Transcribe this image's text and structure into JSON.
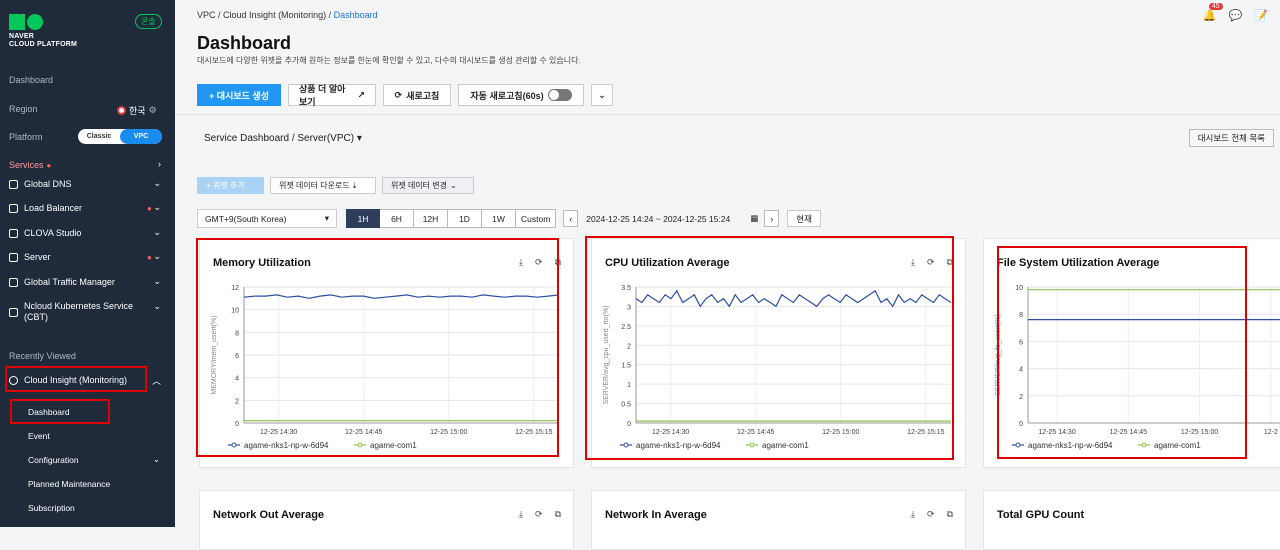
{
  "sidebar": {
    "logo_line1": "NAVER",
    "logo_line2": "CLOUD PLATFORM",
    "badge": "콘솔",
    "dashboard_label": "Dashboard",
    "region_label": "Region",
    "region_value": "한국",
    "platform_label": "Platform",
    "platform_options": [
      "Classic",
      "VPC"
    ],
    "platform_selected": "VPC",
    "services_label": "Services",
    "items": [
      {
        "label": "Global DNS",
        "dot": false
      },
      {
        "label": "Load Balancer",
        "dot": true
      },
      {
        "label": "CLOVA Studio",
        "dot": false
      },
      {
        "label": "Server",
        "dot": true
      },
      {
        "label": "Global Traffic Manager",
        "dot": false
      },
      {
        "label": "Ncloud Kubernetes Service (CBT)",
        "dot": false
      }
    ],
    "recently_viewed_label": "Recently Viewed",
    "recent_item": "Cloud Insight (Monitoring)",
    "sub_items": [
      "Dashboard",
      "Event",
      "Configuration",
      "Planned Maintenance",
      "Subscription"
    ]
  },
  "header": {
    "breadcrumb": [
      "VPC",
      "Cloud Insight (Monitoring)",
      "Dashboard"
    ],
    "notification_count": "45",
    "title": "Dashboard",
    "description": "대시보드에 다양한 위젯을 추가해 원하는 정보를 한눈에 확인할 수 있고, 다수의 대시보드를 생성 관리할 수 있습니다."
  },
  "toolbar": {
    "create_label": "+ 대시보드 생성",
    "more_label": "상품 더 알아보기",
    "refresh_label": "새로고침",
    "auto_refresh_label": "자동 새로고침(60s)"
  },
  "dashboard_bar": {
    "selected": "Service Dashboard / Server(VPC)",
    "all_list_label": "대시보드 전체 목록"
  },
  "widget_bar": {
    "add_label": "+ 위젯 추가",
    "download_label": "위젯 데이터 다운로드",
    "change_label": "위젯 데이터 변경"
  },
  "time_bar": {
    "timezone": "GMT+9(South Korea)",
    "ranges": [
      "1H",
      "6H",
      "12H",
      "1D",
      "1W",
      "Custom"
    ],
    "active_range": "1H",
    "date_range": "2024-12-25 14:24 ~ 2024-12-25 15:24",
    "now_label": "현재"
  },
  "widgets": [
    {
      "title": "Memory Utilization"
    },
    {
      "title": "CPU Utilization Average"
    },
    {
      "title": "File System Utilization Average"
    },
    {
      "title": "Network Out Average"
    },
    {
      "title": "Network In Average"
    },
    {
      "title": "Total GPU Count"
    }
  ],
  "chart_data": [
    {
      "type": "line",
      "title": "Memory Utilization",
      "ylabel": "MEMORY/mem_usert(%)",
      "ylim": [
        0,
        12
      ],
      "yticks": [
        0,
        2,
        4,
        6,
        8,
        10,
        12
      ],
      "xticks": [
        "12-25 14:30",
        "12-25 14:45",
        "12-25 15:00",
        "12-25 15:15"
      ],
      "series": [
        {
          "name": "agame-nks1-np-w-6d94",
          "color": "#2b4fa0",
          "values": [
            11.1,
            11.2,
            11.2,
            11.3,
            11.1,
            11.2,
            11.0,
            11.2,
            11.3,
            11.1,
            11.2,
            11.2,
            11.0,
            11.1,
            11.2,
            11.3,
            11.1,
            11.2,
            11.1,
            11.2,
            11.2,
            11.1,
            11.3,
            11.2,
            11.1,
            11.2,
            11.2,
            11.1,
            11.2,
            11.3
          ]
        },
        {
          "name": "agame-com1",
          "color": "#8bc34a",
          "values": [
            0.2,
            0.2,
            0.2,
            0.2,
            0.2,
            0.2,
            0.2,
            0.2,
            0.2,
            0.2,
            0.2,
            0.2,
            0.2,
            0.2,
            0.2,
            0.2,
            0.2,
            0.2,
            0.2,
            0.2,
            0.2,
            0.2,
            0.2,
            0.2,
            0.2,
            0.2,
            0.2,
            0.2,
            0.2,
            0.2
          ]
        }
      ]
    },
    {
      "type": "line",
      "title": "CPU Utilization Average",
      "ylabel": "SERVER/avg_cpu_used_rto(%)",
      "ylim": [
        0,
        3.5
      ],
      "yticks": [
        0,
        0.5,
        1,
        1.5,
        2,
        2.5,
        3,
        3.5
      ],
      "xticks": [
        "12-25 14:30",
        "12-25 14:45",
        "12-25 15:00",
        "12-25 15:15"
      ],
      "series": [
        {
          "name": "agame-nks1-np-w-6d94",
          "color": "#2b4fa0",
          "values": [
            3.2,
            3.1,
            3.3,
            3.2,
            3.1,
            3.3,
            3.2,
            3.4,
            3.1,
            3.2,
            3.3,
            3.0,
            3.2,
            3.3,
            3.1,
            3.2,
            3.0,
            3.3,
            3.1,
            3.2,
            3.3,
            3.1,
            3.2,
            3.1,
            3.0,
            3.3,
            3.2,
            3.1,
            3.3,
            3.2,
            3.1,
            3.0,
            3.2,
            3.3,
            3.2,
            3.1,
            3.3,
            3.2,
            3.1,
            3.2,
            3.3,
            3.4,
            3.1,
            3.2,
            3.0,
            3.3,
            3.1,
            3.2,
            3.1,
            3.3,
            3.2,
            3.1,
            3.3,
            3.2,
            3.1
          ]
        },
        {
          "name": "agame-com1",
          "color": "#8bc34a",
          "values": [
            0.05,
            0.05,
            0.05,
            0.05,
            0.05,
            0.05,
            0.05,
            0.05,
            0.05,
            0.05,
            0.05,
            0.05,
            0.05,
            0.05,
            0.05,
            0.05,
            0.05,
            0.05,
            0.05,
            0.05,
            0.05,
            0.05,
            0.05,
            0.05,
            0.05,
            0.05,
            0.05,
            0.05,
            0.05,
            0.05
          ]
        }
      ]
    },
    {
      "type": "line",
      "title": "File System Utilization Average",
      "ylabel": "SERVER/avg_fs_usert(%)",
      "ylim": [
        0,
        10
      ],
      "yticks": [
        0,
        2,
        4,
        6,
        8,
        10
      ],
      "xticks": [
        "12-25 14:30",
        "12-25 14:45",
        "12-25 15:00",
        "12-2"
      ],
      "series": [
        {
          "name": "agame-nks1-np-w-6d94",
          "color": "#2b4fa0",
          "values": [
            7.6,
            7.6,
            7.6,
            7.6,
            7.6,
            7.6,
            7.6,
            7.6,
            7.6,
            7.6
          ]
        },
        {
          "name": "agame-com1",
          "color": "#8bc34a",
          "values": [
            9.8,
            9.8,
            9.8,
            9.8,
            9.8,
            9.8,
            9.8,
            9.8,
            9.8,
            9.8
          ]
        }
      ]
    }
  ]
}
